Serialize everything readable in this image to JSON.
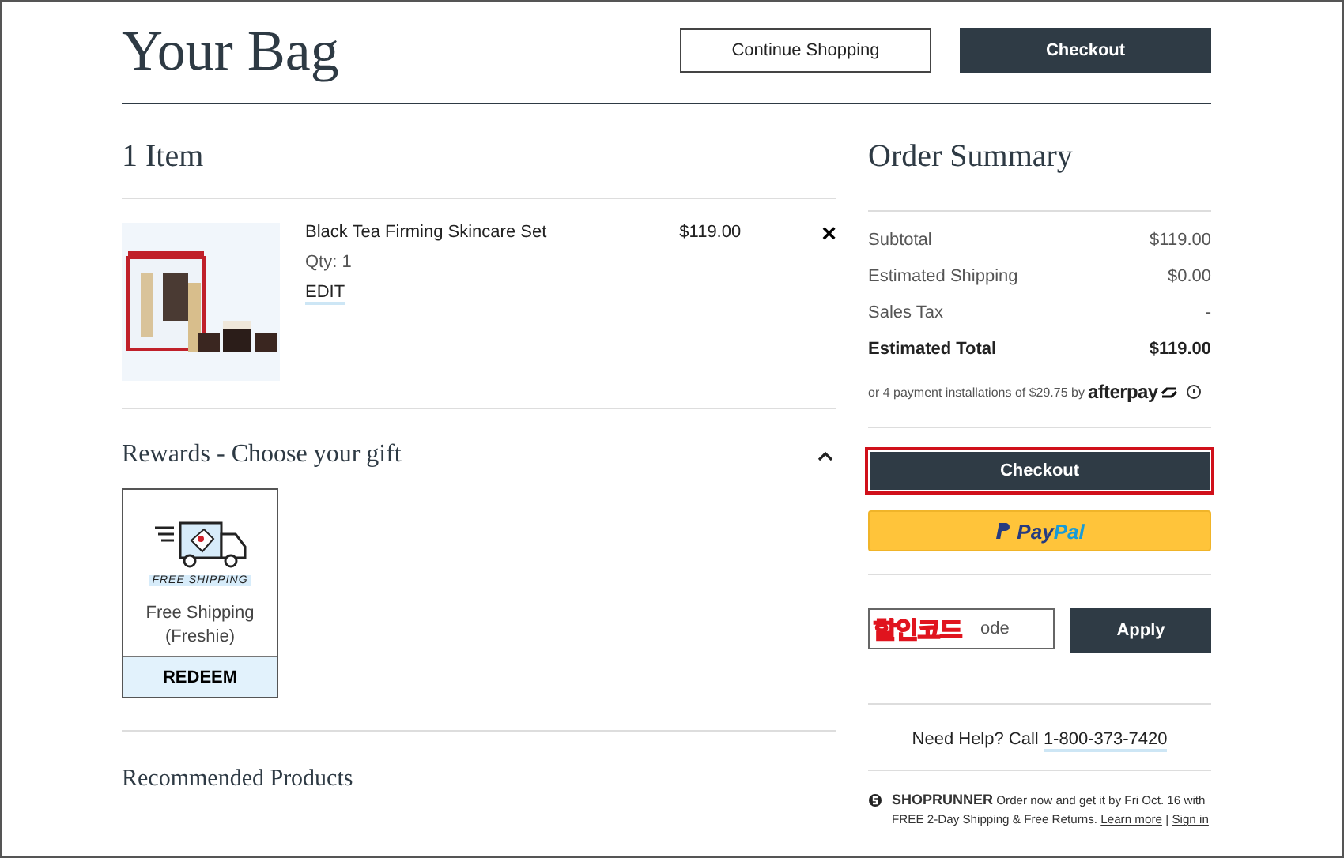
{
  "header": {
    "title": "Your Bag",
    "buttons": [
      {
        "label": "Continue Shopping",
        "kind": "outline"
      },
      {
        "label": "Checkout",
        "kind": "dark"
      }
    ]
  },
  "bag": {
    "count": "1 Item",
    "items": [
      {
        "name": "Black Tea Firming Skincare Set",
        "qty": "Qty: 1",
        "edit": "EDIT",
        "price": "$119.00",
        "remove": "×"
      }
    ]
  },
  "rewards": {
    "title": "Rewards - Choose your gift",
    "expanded": true,
    "gifts": [
      {
        "banner": "FREE SHIPPING",
        "name": "Free Shipping (Freshie)",
        "action": "REDEEM"
      }
    ]
  },
  "recommended": {
    "title": "Recommended Products"
  },
  "summary": {
    "title": "Order Summary",
    "rows": [
      {
        "label": "Subtotal",
        "value": "$119.00",
        "bold": false
      },
      {
        "label": "Estimated Shipping",
        "value": "$0.00",
        "bold": false
      },
      {
        "label": "Sales Tax",
        "value": "-",
        "bold": false
      },
      {
        "label": "Estimated Total",
        "value": "$119.00",
        "bold": true
      }
    ],
    "installments": "or 4 payment installations of $29.75 by",
    "afterpay": "afterpay",
    "checkout": {
      "label": "Checkout",
      "highlighted": true
    },
    "paypal": {
      "pay": "Pay",
      "pal": "Pal"
    },
    "promo": {
      "placeholder": "ode",
      "annotation": "할인코드",
      "apply": "Apply"
    },
    "help": {
      "text": "Need Help? Call",
      "phone": "1-800-373-7420"
    },
    "shoprunner": {
      "brand": "SHOPRUNNER",
      "text": "Order now and get it by Fri Oct. 16 with FREE 2-Day Shipping & Free Returns.",
      "learn": "Learn more",
      "sep": "|",
      "signin": "Sign in"
    }
  }
}
